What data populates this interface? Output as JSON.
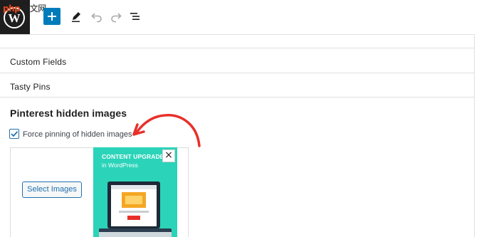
{
  "watermark": {
    "text_a": "php",
    "text_b": "中文网"
  },
  "toolbar": {
    "logo_icon": "wordpress-logo-icon",
    "add_icon": "plus-icon",
    "edit_icon": "pencil-icon",
    "undo_icon": "undo-icon",
    "redo_icon": "redo-icon",
    "outline_icon": "list-view-icon",
    "accent_color": "#007cba"
  },
  "panels": {
    "custom_fields": "Custom Fields",
    "tasty_pins": "Tasty Pins"
  },
  "pinterest": {
    "heading": "Pinterest hidden images",
    "checkbox_label": "Force pinning of hidden images",
    "checkbox_checked": true,
    "select_button": "Select Images"
  },
  "promo": {
    "title": "CONTENT UPGRADE",
    "subtitle": "in WordPress",
    "close": "×",
    "background_color": "#2bd4b9"
  },
  "annotation": {
    "arrow_color": "#e8302a"
  }
}
